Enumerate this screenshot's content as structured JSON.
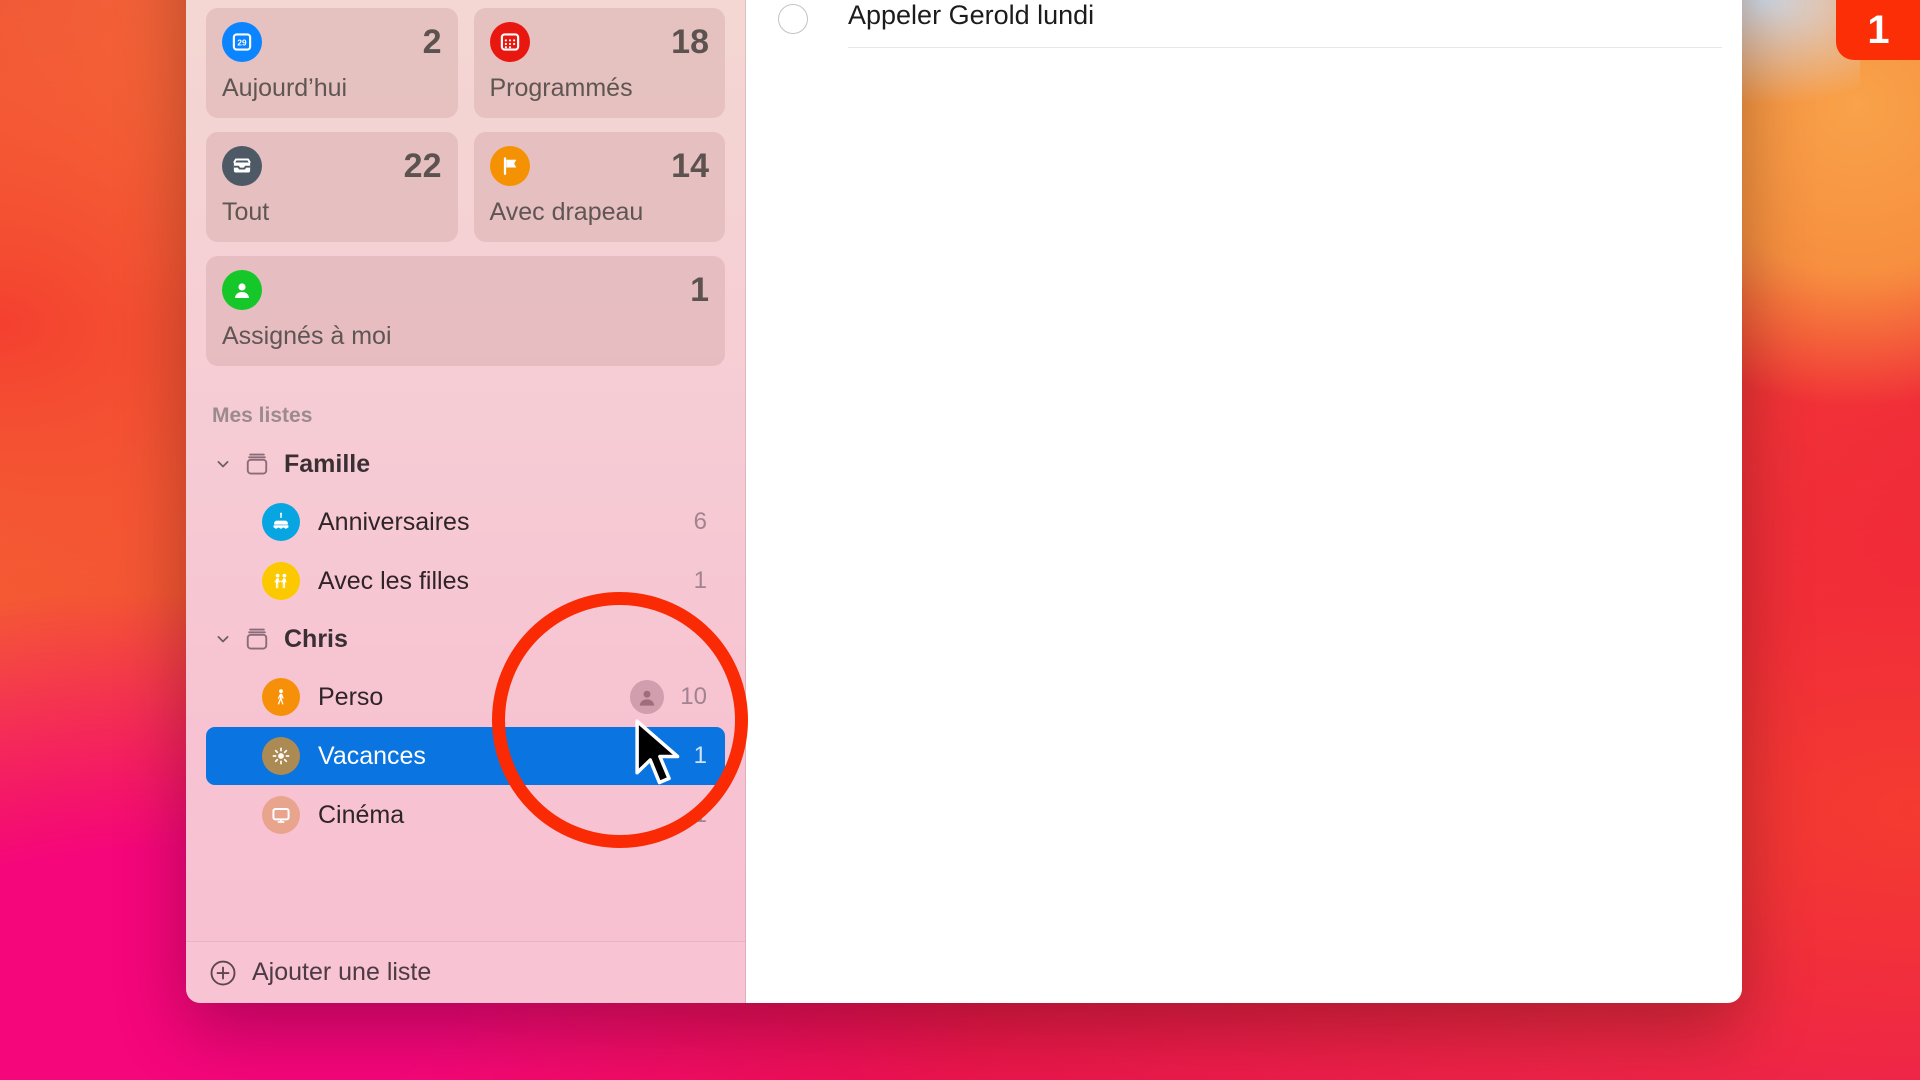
{
  "desktop": {
    "notification_badge": "1",
    "badge_color": "#fb2e06"
  },
  "sidebar": {
    "smart_cards": [
      {
        "label": "Aujourd’hui",
        "count": "2",
        "icon": "calendar-today-icon",
        "icon_color": "#0a84ff",
        "span": false
      },
      {
        "label": "Programmés",
        "count": "18",
        "icon": "calendar-scheduled-icon",
        "icon_color": "#e8170f",
        "span": false
      },
      {
        "label": "Tout",
        "count": "22",
        "icon": "inbox-tray-icon",
        "icon_color": "#4d5a66",
        "span": false
      },
      {
        "label": "Avec drapeau",
        "count": "14",
        "icon": "flag-icon",
        "icon_color": "#f59204",
        "span": false
      },
      {
        "label": "Assignés à moi",
        "count": "1",
        "icon": "person-assigned-icon",
        "icon_color": "#16c729",
        "span": true
      }
    ],
    "section_title": "Mes listes",
    "groups": [
      {
        "name": "Famille",
        "icon": "folder-group-icon",
        "expanded": true,
        "lists": [
          {
            "name": "Anniversaires",
            "count": "6",
            "icon": "cake-icon",
            "icon_color": "#08a5e3",
            "selected": false,
            "shared": false
          },
          {
            "name": "Avec les filles",
            "count": "1",
            "icon": "two-people-icon",
            "icon_color": "#fcc800",
            "selected": false,
            "shared": false
          }
        ]
      },
      {
        "name": "Chris",
        "icon": "folder-group-icon",
        "expanded": true,
        "lists": [
          {
            "name": "Perso",
            "count": "10",
            "icon": "walking-person-icon",
            "icon_color": "#f79009",
            "selected": false,
            "shared": true
          },
          {
            "name": "Vacances",
            "count": "1",
            "icon": "sun-icon",
            "icon_color": "#ab8a53",
            "selected": true,
            "shared": false
          },
          {
            "name": "Cinéma",
            "count": "1",
            "icon": "tv-monitor-icon",
            "icon_color": "#e8a48c",
            "selected": false,
            "shared": false
          }
        ]
      }
    ],
    "footer": {
      "add_list_label": "Ajouter une liste",
      "add_icon": "plus-circle-icon"
    }
  },
  "main": {
    "tasks": [
      {
        "title": "Appeler Gerold lundi",
        "completed": false
      }
    ]
  },
  "annotation": {
    "highlight_color": "#fa2a05",
    "cursor": "arrow-pointer"
  }
}
